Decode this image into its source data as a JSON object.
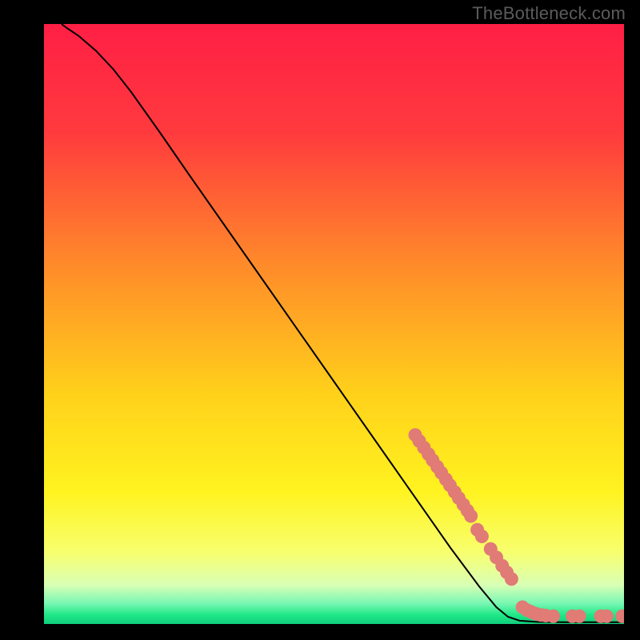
{
  "watermark": "TheBottleneck.com",
  "chart_data": {
    "type": "line",
    "title": "",
    "xlabel": "",
    "ylabel": "",
    "xlim": [
      0,
      100
    ],
    "ylim": [
      0,
      100
    ],
    "background_gradient": {
      "stops": [
        {
          "offset": 0.0,
          "color": "#ff1f45"
        },
        {
          "offset": 0.18,
          "color": "#ff3a3e"
        },
        {
          "offset": 0.4,
          "color": "#ff8a2a"
        },
        {
          "offset": 0.62,
          "color": "#ffd21a"
        },
        {
          "offset": 0.78,
          "color": "#fff320"
        },
        {
          "offset": 0.88,
          "color": "#f8ff6e"
        },
        {
          "offset": 0.935,
          "color": "#d9ffb5"
        },
        {
          "offset": 0.965,
          "color": "#7bf7b3"
        },
        {
          "offset": 0.985,
          "color": "#1fe887"
        },
        {
          "offset": 1.0,
          "color": "#0fce7c"
        }
      ]
    },
    "curve": [
      {
        "x": 3.0,
        "y": 100.0
      },
      {
        "x": 4.0,
        "y": 99.3
      },
      {
        "x": 6.0,
        "y": 98.0
      },
      {
        "x": 9.0,
        "y": 95.5
      },
      {
        "x": 12.0,
        "y": 92.4
      },
      {
        "x": 15.0,
        "y": 88.7
      },
      {
        "x": 20.0,
        "y": 81.9
      },
      {
        "x": 25.0,
        "y": 74.9
      },
      {
        "x": 30.0,
        "y": 68.0
      },
      {
        "x": 35.0,
        "y": 61.1
      },
      {
        "x": 40.0,
        "y": 54.2
      },
      {
        "x": 45.0,
        "y": 47.3
      },
      {
        "x": 50.0,
        "y": 40.4
      },
      {
        "x": 55.0,
        "y": 33.5
      },
      {
        "x": 60.0,
        "y": 26.6
      },
      {
        "x": 65.0,
        "y": 19.7
      },
      {
        "x": 70.0,
        "y": 12.8
      },
      {
        "x": 75.0,
        "y": 6.3
      },
      {
        "x": 78.0,
        "y": 2.8
      },
      {
        "x": 80.0,
        "y": 1.2
      },
      {
        "x": 82.0,
        "y": 0.55
      },
      {
        "x": 85.0,
        "y": 0.35
      },
      {
        "x": 90.0,
        "y": 0.3
      },
      {
        "x": 95.0,
        "y": 0.3
      },
      {
        "x": 100.0,
        "y": 0.3
      }
    ],
    "scatter": [
      {
        "x": 64.0,
        "y": 31.5
      },
      {
        "x": 64.7,
        "y": 30.5
      },
      {
        "x": 65.5,
        "y": 29.4
      },
      {
        "x": 66.3,
        "y": 28.3
      },
      {
        "x": 67.0,
        "y": 27.3
      },
      {
        "x": 67.8,
        "y": 26.2
      },
      {
        "x": 68.5,
        "y": 25.2
      },
      {
        "x": 69.3,
        "y": 24.1
      },
      {
        "x": 70.0,
        "y": 23.1
      },
      {
        "x": 70.8,
        "y": 22.0
      },
      {
        "x": 71.5,
        "y": 21.0
      },
      {
        "x": 72.3,
        "y": 19.9
      },
      {
        "x": 73.0,
        "y": 18.9
      },
      {
        "x": 73.6,
        "y": 18.0
      },
      {
        "x": 74.7,
        "y": 15.7
      },
      {
        "x": 75.5,
        "y": 14.6
      },
      {
        "x": 77.0,
        "y": 12.5
      },
      {
        "x": 78.0,
        "y": 11.1
      },
      {
        "x": 79.0,
        "y": 9.7
      },
      {
        "x": 79.8,
        "y": 8.6
      },
      {
        "x": 80.6,
        "y": 7.5
      },
      {
        "x": 82.5,
        "y": 2.8
      },
      {
        "x": 83.3,
        "y": 2.3
      },
      {
        "x": 84.0,
        "y": 2.0
      },
      {
        "x": 84.8,
        "y": 1.7
      },
      {
        "x": 85.7,
        "y": 1.5
      },
      {
        "x": 86.5,
        "y": 1.4
      },
      {
        "x": 87.8,
        "y": 1.3
      },
      {
        "x": 91.1,
        "y": 1.3
      },
      {
        "x": 92.3,
        "y": 1.3
      },
      {
        "x": 96.0,
        "y": 1.3
      },
      {
        "x": 97.0,
        "y": 1.3
      },
      {
        "x": 99.7,
        "y": 1.3
      }
    ],
    "marker_color": "#e07b76",
    "line_color": "#000000"
  }
}
